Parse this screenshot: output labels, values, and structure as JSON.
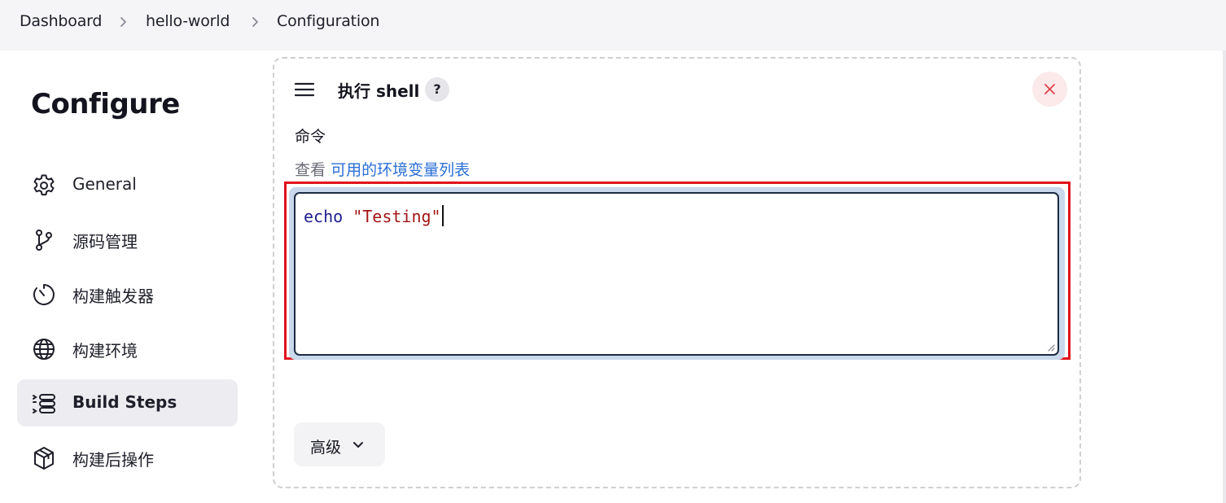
{
  "breadcrumb": {
    "items": [
      "Dashboard",
      "hello-world",
      "Configuration"
    ]
  },
  "sidebar": {
    "title": "Configure",
    "items": [
      {
        "label": "General",
        "icon": "gear-icon",
        "active": false
      },
      {
        "label": "源码管理",
        "icon": "branch-icon",
        "active": false
      },
      {
        "label": "构建触发器",
        "icon": "timer-icon",
        "active": false
      },
      {
        "label": "构建环境",
        "icon": "globe-icon",
        "active": false
      },
      {
        "label": "Build Steps",
        "icon": "list-steps-icon",
        "active": true
      },
      {
        "label": "构建后操作",
        "icon": "package-icon",
        "active": false
      }
    ]
  },
  "step": {
    "title": "执行 shell",
    "help_label": "?",
    "command_label": "命令",
    "env_prefix": "查看",
    "env_link": "可用的环境变量列表",
    "command_keyword": "echo",
    "command_string": "\"Testing\"",
    "advanced_label": "高级"
  },
  "colors": {
    "highlight": "#e0121b",
    "link": "#2b6fd6",
    "close_bg": "#fce9ea",
    "close_icon": "#e0424b",
    "active_nav_bg": "#ededf1"
  }
}
